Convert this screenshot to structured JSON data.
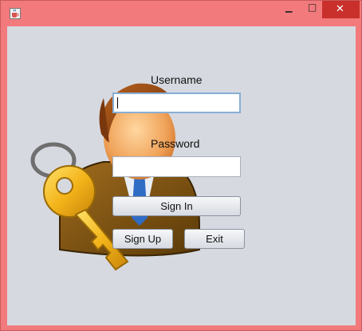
{
  "window": {
    "title": "",
    "minimize_glyph": "▁",
    "maximize_glyph": "□",
    "close_glyph": "✕",
    "frame_color": "#f27a7c",
    "close_color": "#c9302c",
    "content_bg": "#d6d9e0"
  },
  "form": {
    "username_label": "Username",
    "username_value": "",
    "password_label": "Password",
    "password_value": ""
  },
  "buttons": {
    "sign_in": "Sign In",
    "sign_up": "Sign Up",
    "exit": "Exit"
  },
  "icons": {
    "app": "java-cup-icon",
    "illustration": "user-with-key-icon"
  }
}
